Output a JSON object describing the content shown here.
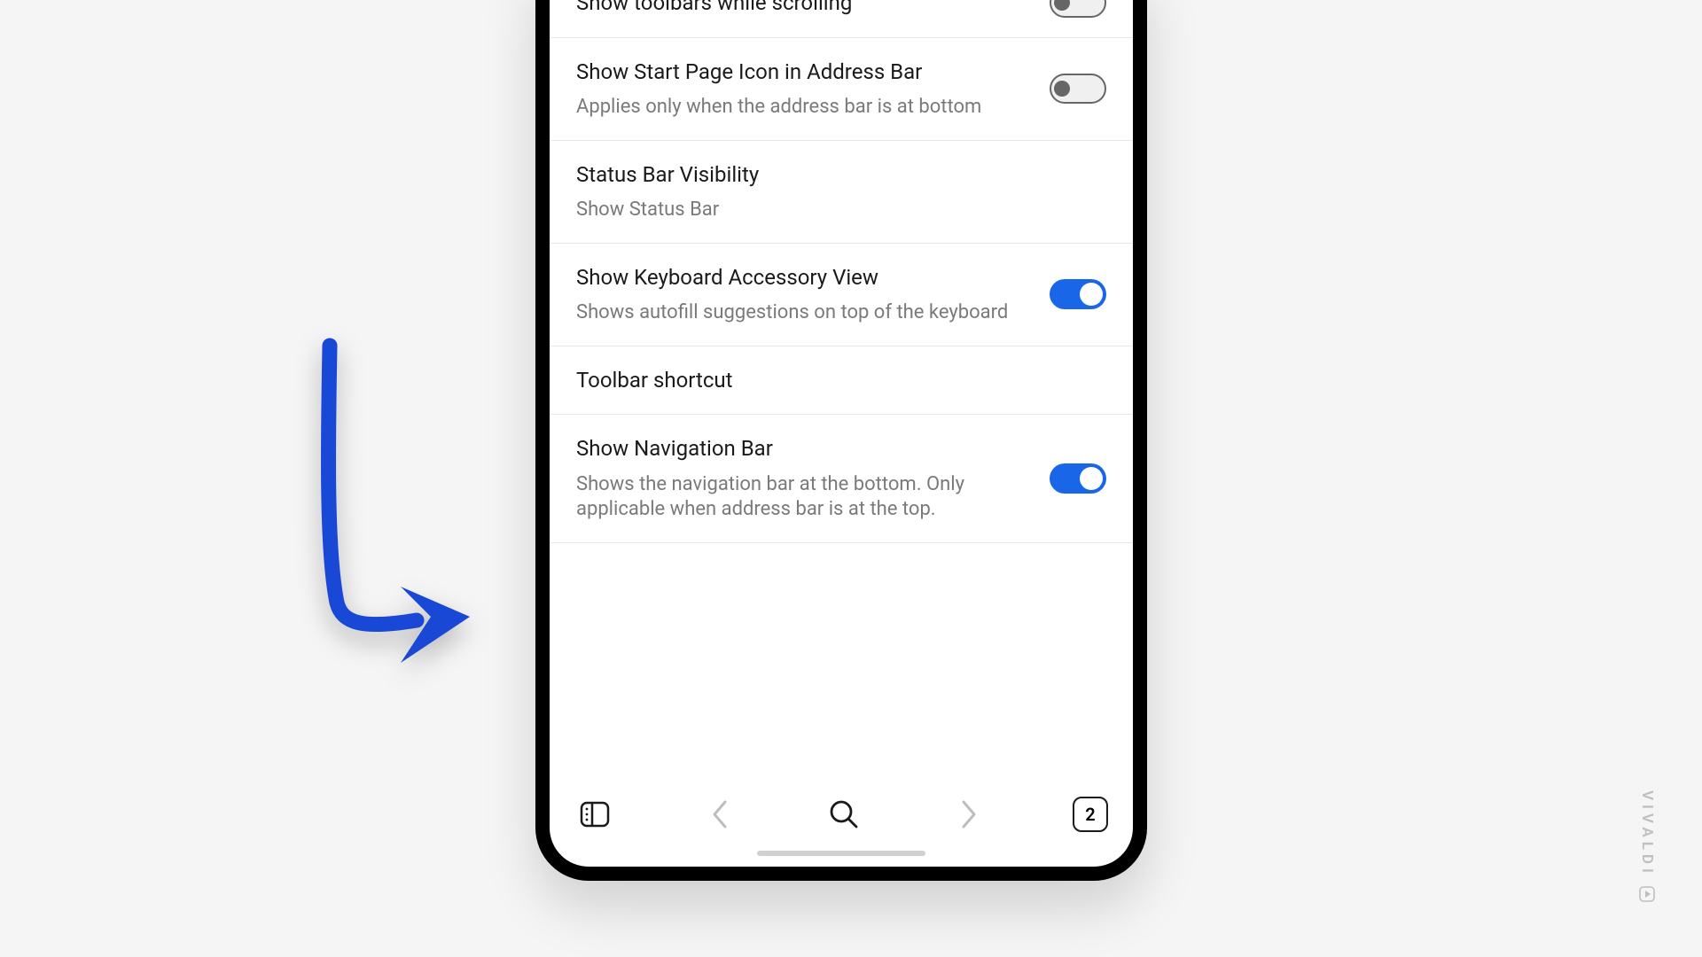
{
  "settings": [
    {
      "title": "Show toolbars while scrolling",
      "sub": null,
      "toggle": "off"
    },
    {
      "title": "Show Start Page Icon in Address Bar",
      "sub": "Applies only when the address bar is at bottom",
      "toggle": "off"
    },
    {
      "title": "Status Bar Visibility",
      "sub": "Show Status Bar",
      "toggle": null
    },
    {
      "title": "Show Keyboard Accessory View",
      "sub": "Shows autofill suggestions on top of the keyboard",
      "toggle": "on"
    },
    {
      "title": "Toolbar shortcut",
      "sub": null,
      "toggle": null
    },
    {
      "title": "Show Navigation Bar",
      "sub": "Shows the navigation bar at the bottom. Only applicable when address bar is at the top.",
      "toggle": "on"
    }
  ],
  "navbar": {
    "tab_count": "2"
  },
  "brand": "VIVALDI"
}
